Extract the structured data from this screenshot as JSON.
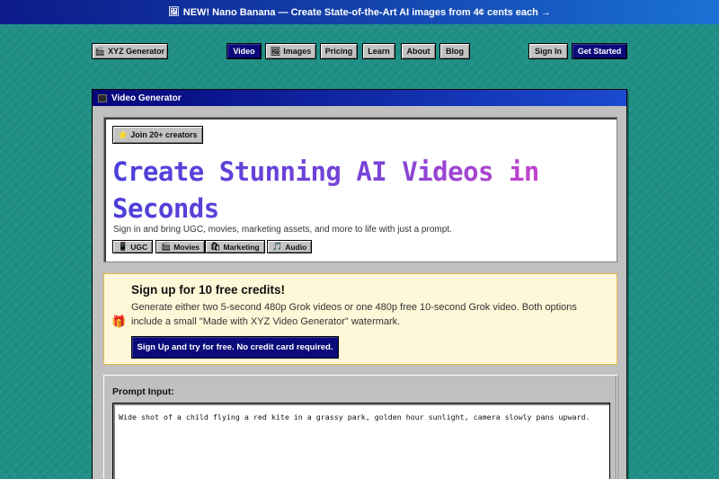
{
  "promo": {
    "icon": "🖼",
    "text": "NEW! Nano Banana — Create State-of-the-Art AI images from 4¢ cents each →"
  },
  "nav": {
    "logo": {
      "icon": "🎬",
      "label": "XYZ Generator"
    },
    "links": [
      {
        "label": "Video",
        "active": true
      },
      {
        "label": "Images",
        "icon": "🖼"
      },
      {
        "label": "Pricing"
      },
      {
        "label": "Learn"
      },
      {
        "label": "About"
      },
      {
        "label": "Blog"
      }
    ],
    "sign_in": "Sign In",
    "get_started": "Get Started"
  },
  "window": {
    "title": "Video Generator"
  },
  "hero": {
    "badge": {
      "icon": "⭐",
      "label": "Join 20+ creators"
    },
    "headline": "Create Stunning AI Videos in Seconds",
    "subtitle": "Sign in and bring UGC, movies, marketing assets, and more to life with just a prompt.",
    "tags": [
      {
        "icon": "📱",
        "label": "UGC"
      },
      {
        "icon": "🎬",
        "label": "Movies"
      },
      {
        "icon": "🛍",
        "label": "Marketing"
      },
      {
        "icon": "🎵",
        "label": "Audio"
      }
    ]
  },
  "credits": {
    "icon": "🎁",
    "title": "Sign up for 10 free credits!",
    "body": "Generate either two 5-second 480p Grok videos or one 480p free 10-second Grok video. Both options include a small \"Made with XYZ Video Generator\" watermark.",
    "button": "Sign Up and try for free. No credit card required."
  },
  "prompt": {
    "label": "Prompt Input:",
    "value": "Wide shot of a child flying a red kite in a grassy park, golden hour sunlight, camera slowly pans upward."
  },
  "colors": {
    "background": "#1f8f86",
    "promo_start": "#0c1a8a",
    "promo_end": "#1a72d4",
    "accent_button": "#0a0a7a",
    "headline_start": "#4a3fd8",
    "headline_end": "#d444c8",
    "credits_bg": "#fef7d8",
    "credits_border": "#e5b64a"
  }
}
